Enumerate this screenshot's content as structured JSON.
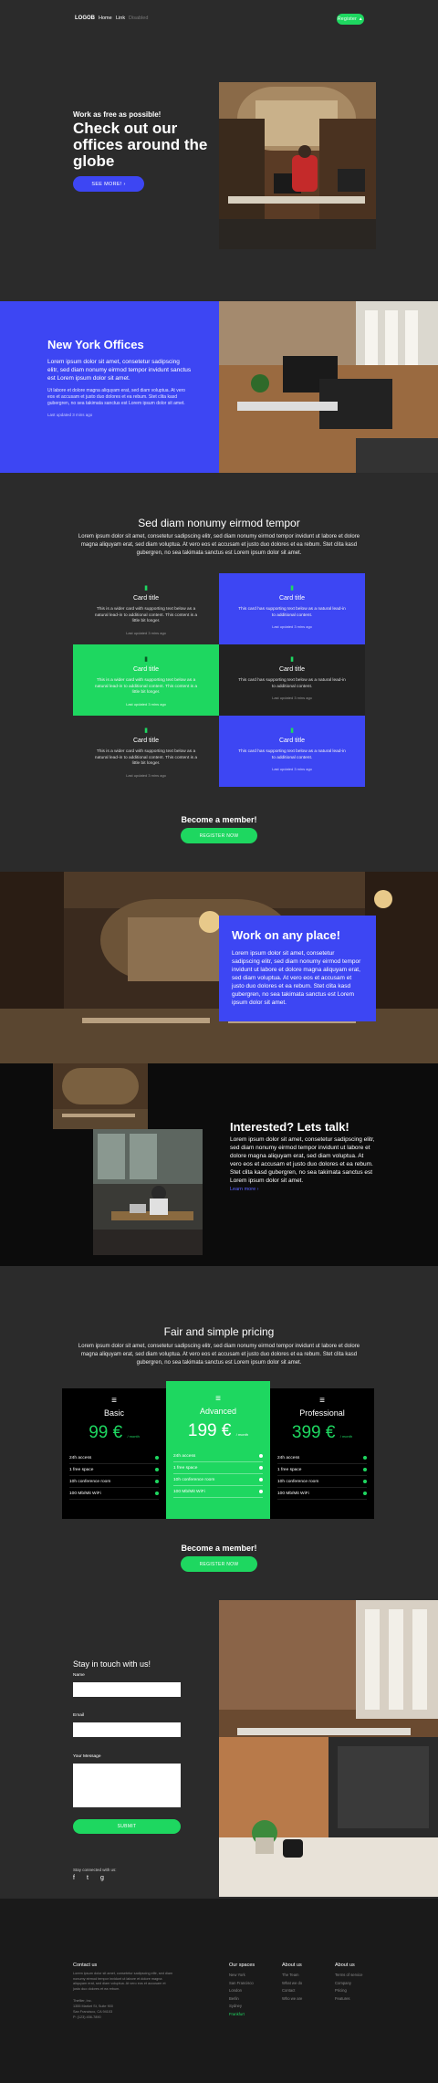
{
  "nav": {
    "logo": "LOGOB",
    "links": [
      "Home",
      "Link",
      "Disabled"
    ],
    "register_label": "Register ▲"
  },
  "hero": {
    "kicker": "Work as free as possible!",
    "title": "Check out our offices around the globe",
    "button": "SEE MORE! ›"
  },
  "ny": {
    "title": "New York Offices",
    "p1": "Lorem ipsum dolor sit amet, consetetur sadipscing elitr, sed diam nonumy eirmod tempor invidunt sanctus est Lorem ipsum dolor sit amet.",
    "p2": "Ut labore et dolore magna aliquyam erat, sed diam voluptua. At vero eos et accusam et justo duo dolores et ea rebum. Stet clita kasd gubergren, no sea takimata sanctus est Lorem ipsum dolor sit amet.",
    "updated": "Last updated 3 mins ago"
  },
  "cards_section": {
    "title": "Sed diam nonumy eirmod tempor",
    "paragraph": "Lorem ipsum dolor sit amet, consetetur sadipscing elitr, sed diam nonumy eirmod tempor invidunt ut labore et dolore magna aliquyam erat, sed diam voluptua. At vero eos et accusam et justo duo dolores et ea rebum. Stet clita kasd gubergren, no sea takimata sanctus est Lorem ipsum dolor sit amet.",
    "cards": [
      {
        "icon": "▮",
        "title": "Card title",
        "text": "This is a wider card with supporting text below as a natural lead-in to additional content. This content is a little bit longer.",
        "updated": "Last updated 3 mins ago"
      },
      {
        "icon": "▮",
        "title": "Card title",
        "text": "This card has supporting text below as a natural lead-in to additional content.",
        "updated": "Last updated 3 mins ago"
      },
      {
        "icon": "▮",
        "title": "Card title",
        "text": "This is a wider card with supporting text below as a natural lead-in to additional content. This content is a little bit longer.",
        "updated": "Last updated 3 mins ago"
      },
      {
        "icon": "▮",
        "title": "Card title",
        "text": "This card has supporting text below as a natural lead-in to additional content.",
        "updated": "Last updated 3 mins ago"
      },
      {
        "icon": "▮",
        "title": "Card title",
        "text": "This is a wider card with supporting text below as a natural lead-in to additional content. This content is a little bit longer.",
        "updated": "Last updated 3 mins ago"
      },
      {
        "icon": "▮",
        "title": "Card title",
        "text": "This card has supporting text below as a natural lead-in to additional content.",
        "updated": "Last updated 3 mins ago"
      }
    ]
  },
  "member1": {
    "title": "Become a member!",
    "button": "REGISTER NOW"
  },
  "work_anyplace": {
    "title": "Work on any place!",
    "paragraph": "Lorem ipsum dolor sit amet, consetetur sadipscing elitr, sed diam nonumy eirmod tempor invidunt ut labore et dolore magna aliquyam erat, sed diam voluptua. At vero eos et accusam et justo duo dolores et ea rebum. Stet clita kasd gubergren, no sea takimata sanctus est Lorem ipsum dolor sit amet."
  },
  "talk": {
    "title": "Interested? Lets talk!",
    "paragraph": "Lorem ipsum dolor sit amet, consetetur sadipscing elitr, sed diam nonumy eirmod tempor invidunt ut labore et dolore magna aliquyam erat, sed diam voluptua. At vero eos et accusam et justo duo dolores et ea rebum. Stet clita kasd gubergren, no sea takimata sanctus est Lorem ipsum dolor sit amet.",
    "link": "Learn more ›"
  },
  "pricing": {
    "title": "Fair and simple pricing",
    "paragraph": "Lorem ipsum dolor sit amet, consetetur sadipscing elitr, sed diam nonumy eirmod tempor invidunt ut labore et dolore magna aliquyam erat, sed diam voluptua. At vero eos et accusam et justo duo dolores et ea rebum. Stet clita kasd gubergren, no sea takimata sanctus est Lorem ipsum dolor sit amet.",
    "plans": [
      {
        "icon": "≡",
        "name": "Basic",
        "price": "99 €",
        "per": "/ month",
        "features": [
          "24h access",
          "1 free space",
          "10h conference room",
          "100 Mb/Mit WiFi"
        ]
      },
      {
        "icon": "≡",
        "name": "Advanced",
        "price": "199 €",
        "per": "/ month",
        "features": [
          "24h access",
          "1 free space",
          "10h conference room",
          "100 Mb/Mit WiFi"
        ]
      },
      {
        "icon": "≡",
        "name": "Professional",
        "price": "399 €",
        "per": "/ month",
        "features": [
          "24h access",
          "1 free space",
          "10h conference room",
          "100 Mb/Mit WiFi"
        ]
      }
    ]
  },
  "member2": {
    "title": "Become a member!",
    "button": "REGISTER NOW"
  },
  "contact": {
    "title": "Stay in touch with us!",
    "name_label": "Name",
    "email_label": "Email",
    "message_label": "Your Message",
    "submit": "SUBMIT",
    "social_label": "Stay connected with us:",
    "social_icons": [
      "f",
      "t",
      "g"
    ]
  },
  "footer": {
    "contact_head": "Contact us",
    "contact_text": "Lorem ipsum dolor sit amet, consetetur sadipscing elitr, sed diam nonumy eirmod tempor invidunt ut labore et dolore magna aliquyam erat, sed diam voluptua. At vero eos et accusam et justo duo dolores et ea rebum.",
    "company": "Thefiler, Inc.",
    "address1": "1355 Market St, Suite 900",
    "address2": "San Francisco, CA 94103",
    "phone": "P: (123) 456-7890",
    "spaces_head": "Our spaces",
    "spaces": [
      "New York",
      "San Francisco",
      "London",
      "Berlin",
      "Sydney",
      "Frankfurt"
    ],
    "about_head": "About us",
    "about": [
      "The Team",
      "What we do",
      "Contact",
      "Who we are"
    ],
    "about2_head": "About us",
    "about2": [
      "Terms of service",
      "Company",
      "Pricing",
      "Features"
    ]
  },
  "colors": {
    "accent": "#1ed760",
    "blue": "#3d46f3",
    "bg": "#2b2b2b"
  }
}
